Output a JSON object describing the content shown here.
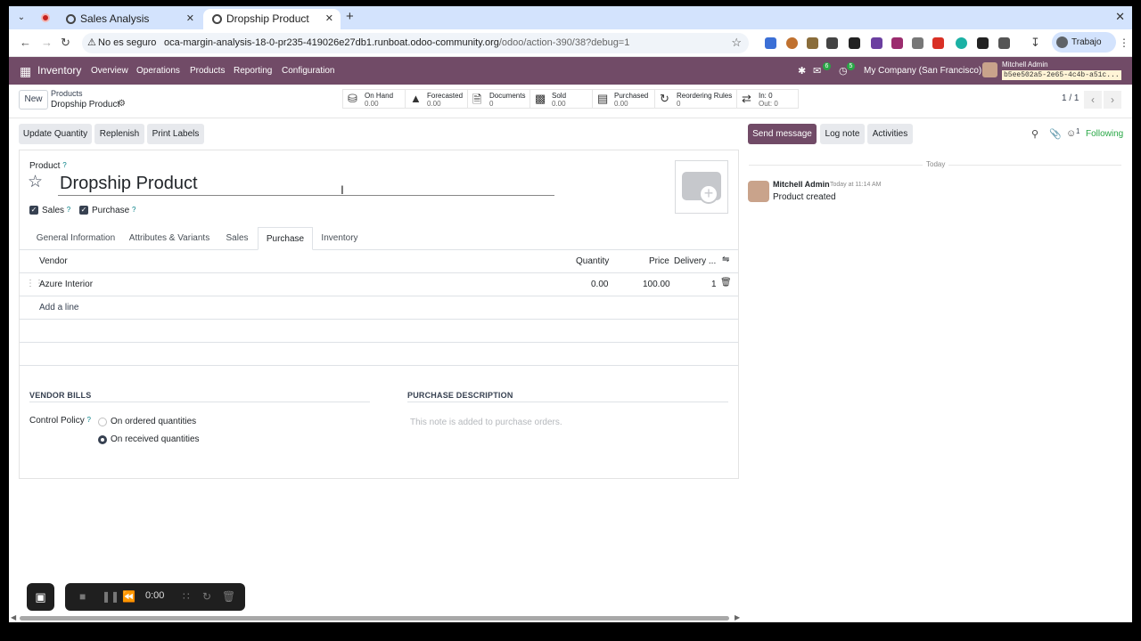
{
  "browser": {
    "tabs": [
      {
        "title": "Sales Analysis",
        "active": false
      },
      {
        "title": "Dropship Product",
        "active": true
      }
    ],
    "security_label": "No es seguro",
    "url_host": "oca-margin-analysis-18-0-pr235-419026e27db1.runboat.odoo-community.org",
    "url_path": "/odoo/action-390/38?debug=1",
    "profile_label": "Trabajo"
  },
  "navbar": {
    "app_name": "Inventory",
    "menus": [
      "Overview",
      "Operations",
      "Products",
      "Reporting",
      "Configuration"
    ],
    "messages_count": "6",
    "activities_count": "5",
    "company": "My Company (San Francisco)",
    "user_name": "Mitchell Admin",
    "db_name": "b5ee502a5-2e65-4c4b-a51c..."
  },
  "control": {
    "new_label": "New",
    "breadcrumb_parent": "Products",
    "record_name": "Dropship Product",
    "smart_buttons": [
      {
        "label": "On Hand",
        "value": "0.00",
        "icon": "cubes-icon"
      },
      {
        "label": "Forecasted",
        "value": "0.00",
        "icon": "area-chart-icon"
      },
      {
        "label": "Documents",
        "value": "0",
        "icon": "file-icon"
      },
      {
        "label": "Sold",
        "value": "0.00",
        "icon": "signal-icon"
      },
      {
        "label": "Purchased",
        "value": "0.00",
        "icon": "credit-card-icon"
      },
      {
        "label": "Reordering Rules",
        "value": "0",
        "icon": "refresh-icon"
      },
      {
        "label": "In: 0",
        "value": "Out: 0",
        "icon": "exchange-icon"
      }
    ],
    "pager": "1 / 1"
  },
  "actions": [
    "Update Quantity",
    "Replenish",
    "Print Labels"
  ],
  "form": {
    "product_label": "Product",
    "help": "?",
    "name": "Dropship Product",
    "sales_label": "Sales",
    "purchase_label": "Purchase",
    "tabs": [
      "General Information",
      "Attributes & Variants",
      "Sales",
      "Purchase",
      "Inventory"
    ],
    "active_tab": "Purchase",
    "vendor_table": {
      "columns": [
        "Vendor",
        "Quantity",
        "Price",
        "Delivery ..."
      ],
      "rows": [
        {
          "vendor": "Azure Interior",
          "quantity": "0.00",
          "price": "100.00",
          "delivery": "1"
        }
      ],
      "add_line": "Add a line"
    },
    "vendor_bills_title": "VENDOR BILLS",
    "control_policy_label": "Control Policy",
    "control_policy_options": [
      "On ordered quantities",
      "On received quantities"
    ],
    "control_policy_selected": "On received quantities",
    "purchase_description_title": "PURCHASE DESCRIPTION",
    "purchase_description_placeholder": "This note is added to purchase orders."
  },
  "chatter": {
    "send_message": "Send message",
    "log_note": "Log note",
    "activities": "Activities",
    "followers_count": "1",
    "following": "Following",
    "date_separator": "Today",
    "messages": [
      {
        "author": "Mitchell Admin",
        "time": "Today at 11:14 AM",
        "body": "Product created"
      }
    ]
  },
  "recorder": {
    "time": "0:00"
  },
  "colors": {
    "brand": "#714b67",
    "accent": "#017e84",
    "success": "#28a745"
  }
}
